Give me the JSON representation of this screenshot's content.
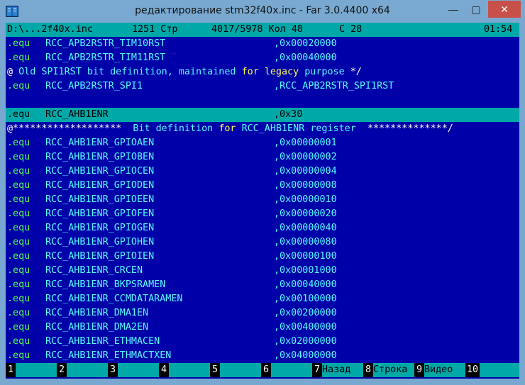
{
  "window": {
    "title": "редактирование stm32f40x.inc - Far 3.0.4400 x64",
    "minimize_glyph": "—",
    "maximize_glyph": "▢",
    "close_glyph": "✕",
    "icon": "far-manager-icon"
  },
  "status": {
    "path": "D:\\...2f40x.inc",
    "line": "1251 Стр",
    "pos": "4017/5978 Кол 48",
    "col": "С 28",
    "clock": "01:54"
  },
  "lines": [
    {
      "dir": ".equ",
      "name": "RCC_APB2RSTR_TIM10RST",
      "val": ",0x00020000"
    },
    {
      "dir": ".equ",
      "name": "RCC_APB2RSTR_TIM11RST",
      "val": ",0x00040000"
    },
    {
      "comment": "@ Old SPI1RST bit definition, maintained for legacy purpose */"
    },
    {
      "dir": ".equ",
      "name": "RCC_APB2RSTR_SPI1",
      "val": ",RCC_APB2RSTR_SPI1RST"
    },
    {
      "blank": ""
    },
    {
      "dir": ".equ",
      "name": "RCC_AHB1ENR",
      "val": ",0x30"
    },
    {
      "comment": "@*******************  Bit definition for RCC_AHB1ENR register  **************/"
    },
    {
      "dir": ".equ",
      "name": "RCC_AHB1ENR_GPIOAEN",
      "val": ",0x00000001"
    },
    {
      "dir": ".equ",
      "name": "RCC_AHB1ENR_GPIOBEN",
      "val": ",0x00000002"
    },
    {
      "dir": ".equ",
      "name": "RCC_AHB1ENR_GPIOCEN",
      "val": ",0x00000004"
    },
    {
      "dir": ".equ",
      "name": "RCC_AHB1ENR_GPIODEN",
      "val": ",0x00000008"
    },
    {
      "dir": ".equ",
      "name": "RCC_AHB1ENR_GPIOEEN",
      "val": ",0x00000010"
    },
    {
      "dir": ".equ",
      "name": "RCC_AHB1ENR_GPIOFEN",
      "val": ",0x00000020"
    },
    {
      "dir": ".equ",
      "name": "RCC_AHB1ENR_GPIOGEN",
      "val": ",0x00000040"
    },
    {
      "dir": ".equ",
      "name": "RCC_AHB1ENR_GPIOHEN",
      "val": ",0x00000080"
    },
    {
      "dir": ".equ",
      "name": "RCC_AHB1ENR_GPIOIEN",
      "val": ",0x00000100"
    },
    {
      "dir": ".equ",
      "name": "RCC_AHB1ENR_CRCEN",
      "val": ",0x00001000"
    },
    {
      "dir": ".equ",
      "name": "RCC_AHB1ENR_BKPSRAMEN",
      "val": ",0x00040000"
    },
    {
      "dir": ".equ",
      "name": "RCC_AHB1ENR_CCMDATARAMEN",
      "val": ",0x00100000"
    },
    {
      "dir": ".equ",
      "name": "RCC_AHB1ENR_DMA1EN",
      "val": ",0x00200000"
    },
    {
      "dir": ".equ",
      "name": "RCC_AHB1ENR_DMA2EN",
      "val": ",0x00400000"
    },
    {
      "dir": ".equ",
      "name": "RCC_AHB1ENR_ETHMACEN",
      "val": ",0x02000000"
    },
    {
      "dir": ".equ",
      "name": "RCC_AHB1ENR_ETHMACTXEN",
      "val": ",0x04000000"
    }
  ],
  "keybar": [
    {
      "num": "1",
      "label": ""
    },
    {
      "num": "2",
      "label": ""
    },
    {
      "num": "3",
      "label": ""
    },
    {
      "num": "4",
      "label": ""
    },
    {
      "num": "5",
      "label": ""
    },
    {
      "num": "6",
      "label": ""
    },
    {
      "num": "7",
      "label": "Назад"
    },
    {
      "num": "8",
      "label": "Строка"
    },
    {
      "num": "9",
      "label": "Видео"
    },
    {
      "num": "10",
      "label": ""
    }
  ],
  "colors": {
    "background": "#0000a8",
    "status_bar": "#00a8a8",
    "directive": "#54fc54",
    "text": "#54fcfc",
    "keyword": "#fcfc54",
    "symbol": "#fcfcfc"
  }
}
